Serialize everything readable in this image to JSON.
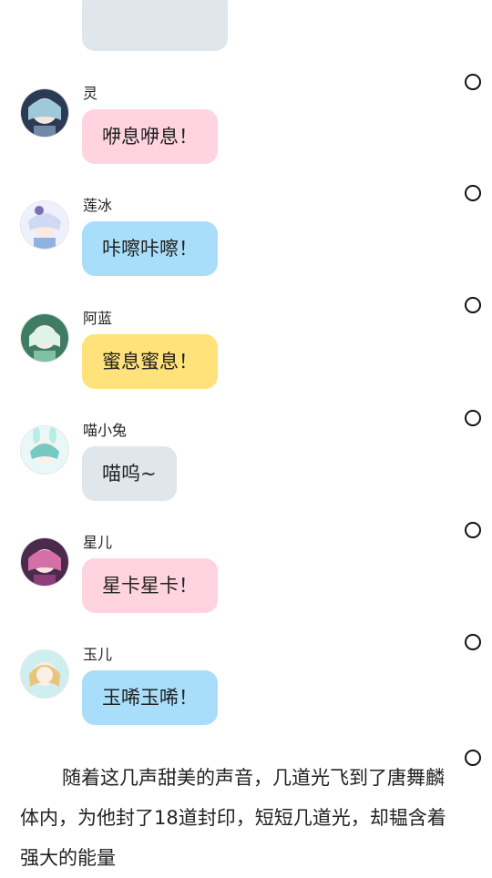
{
  "messages": [
    {
      "name": "灵",
      "text": "咿息咿息！",
      "bubble_color": "#ffd3df",
      "avatar_palette": [
        "#2b3a55",
        "#9fc8d8"
      ]
    },
    {
      "name": "莲冰",
      "text": "咔嚓咔嚓！",
      "bubble_color": "#a9defa",
      "avatar_palette": [
        "#cfd9f2",
        "#7b6fb5"
      ]
    },
    {
      "name": "阿蓝",
      "text": "蜜息蜜息！",
      "bubble_color": "#ffe27a",
      "avatar_palette": [
        "#3e7d63",
        "#dff3e9"
      ]
    },
    {
      "name": "喵小兔",
      "text": "喵呜~",
      "bubble_color": "#dfe6ec",
      "avatar_palette": [
        "#b9ebe8",
        "#3fb6b0"
      ]
    },
    {
      "name": "星儿",
      "text": "星卡星卡！",
      "bubble_color": "#ffd3df",
      "avatar_palette": [
        "#4b2a4d",
        "#d46fa8"
      ]
    },
    {
      "name": "玉儿",
      "text": "玉唏玉唏！",
      "bubble_color": "#a9defa",
      "avatar_palette": [
        "#cfeef0",
        "#e8c57a"
      ]
    }
  ],
  "narration": "随着这几声甜美的声音，几道光飞到了唐舞麟体内，为他封了18道封印，短短几道光，却韫含着强大的能量"
}
